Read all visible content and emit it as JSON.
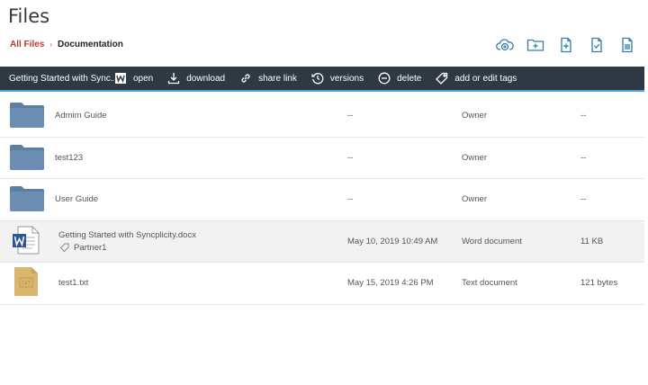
{
  "page": {
    "title": "Files"
  },
  "breadcrumb": {
    "root": "All Files",
    "separator": "›",
    "current": "Documentation"
  },
  "top_actions": [
    {
      "name": "upload-cloud-icon"
    },
    {
      "name": "new-folder-icon"
    },
    {
      "name": "new-file-icon"
    },
    {
      "name": "checklist-icon"
    },
    {
      "name": "trash-icon"
    }
  ],
  "actionbar": {
    "selected_file": "Getting Started with Sync...",
    "open": "open",
    "download": "download",
    "share_link": "share link",
    "versions": "versions",
    "delete": "delete",
    "tags": "add or edit tags"
  },
  "files": [
    {
      "name": "Admim Guide",
      "modified": "--",
      "type": "Owner",
      "size": "--",
      "icon": "folder-icon"
    },
    {
      "name": "test123",
      "modified": "--",
      "type": "Owner",
      "size": "--",
      "icon": "folder-icon"
    },
    {
      "name": "User Guide",
      "modified": "--",
      "type": "Owner",
      "size": "--",
      "icon": "folder-icon"
    },
    {
      "name": "Getting Started with Syncplicity.docx",
      "tag": "Partner1",
      "modified": "May 10, 2019 10:49 AM",
      "type": "Word document",
      "size": "11 KB",
      "icon": "word-document-icon"
    },
    {
      "name": "test1.txt",
      "modified": "May 15, 2019 4:26 PM",
      "type": "Text document",
      "size": "121 bytes",
      "icon": "text-document-icon",
      "icon_label": "TXT"
    }
  ],
  "colors": {
    "accent": "#c0392b",
    "bar": "#2f3944",
    "bar_border": "#4aa3df",
    "folder": "#5b7fa3",
    "icon_blue": "#2f7ea8"
  }
}
